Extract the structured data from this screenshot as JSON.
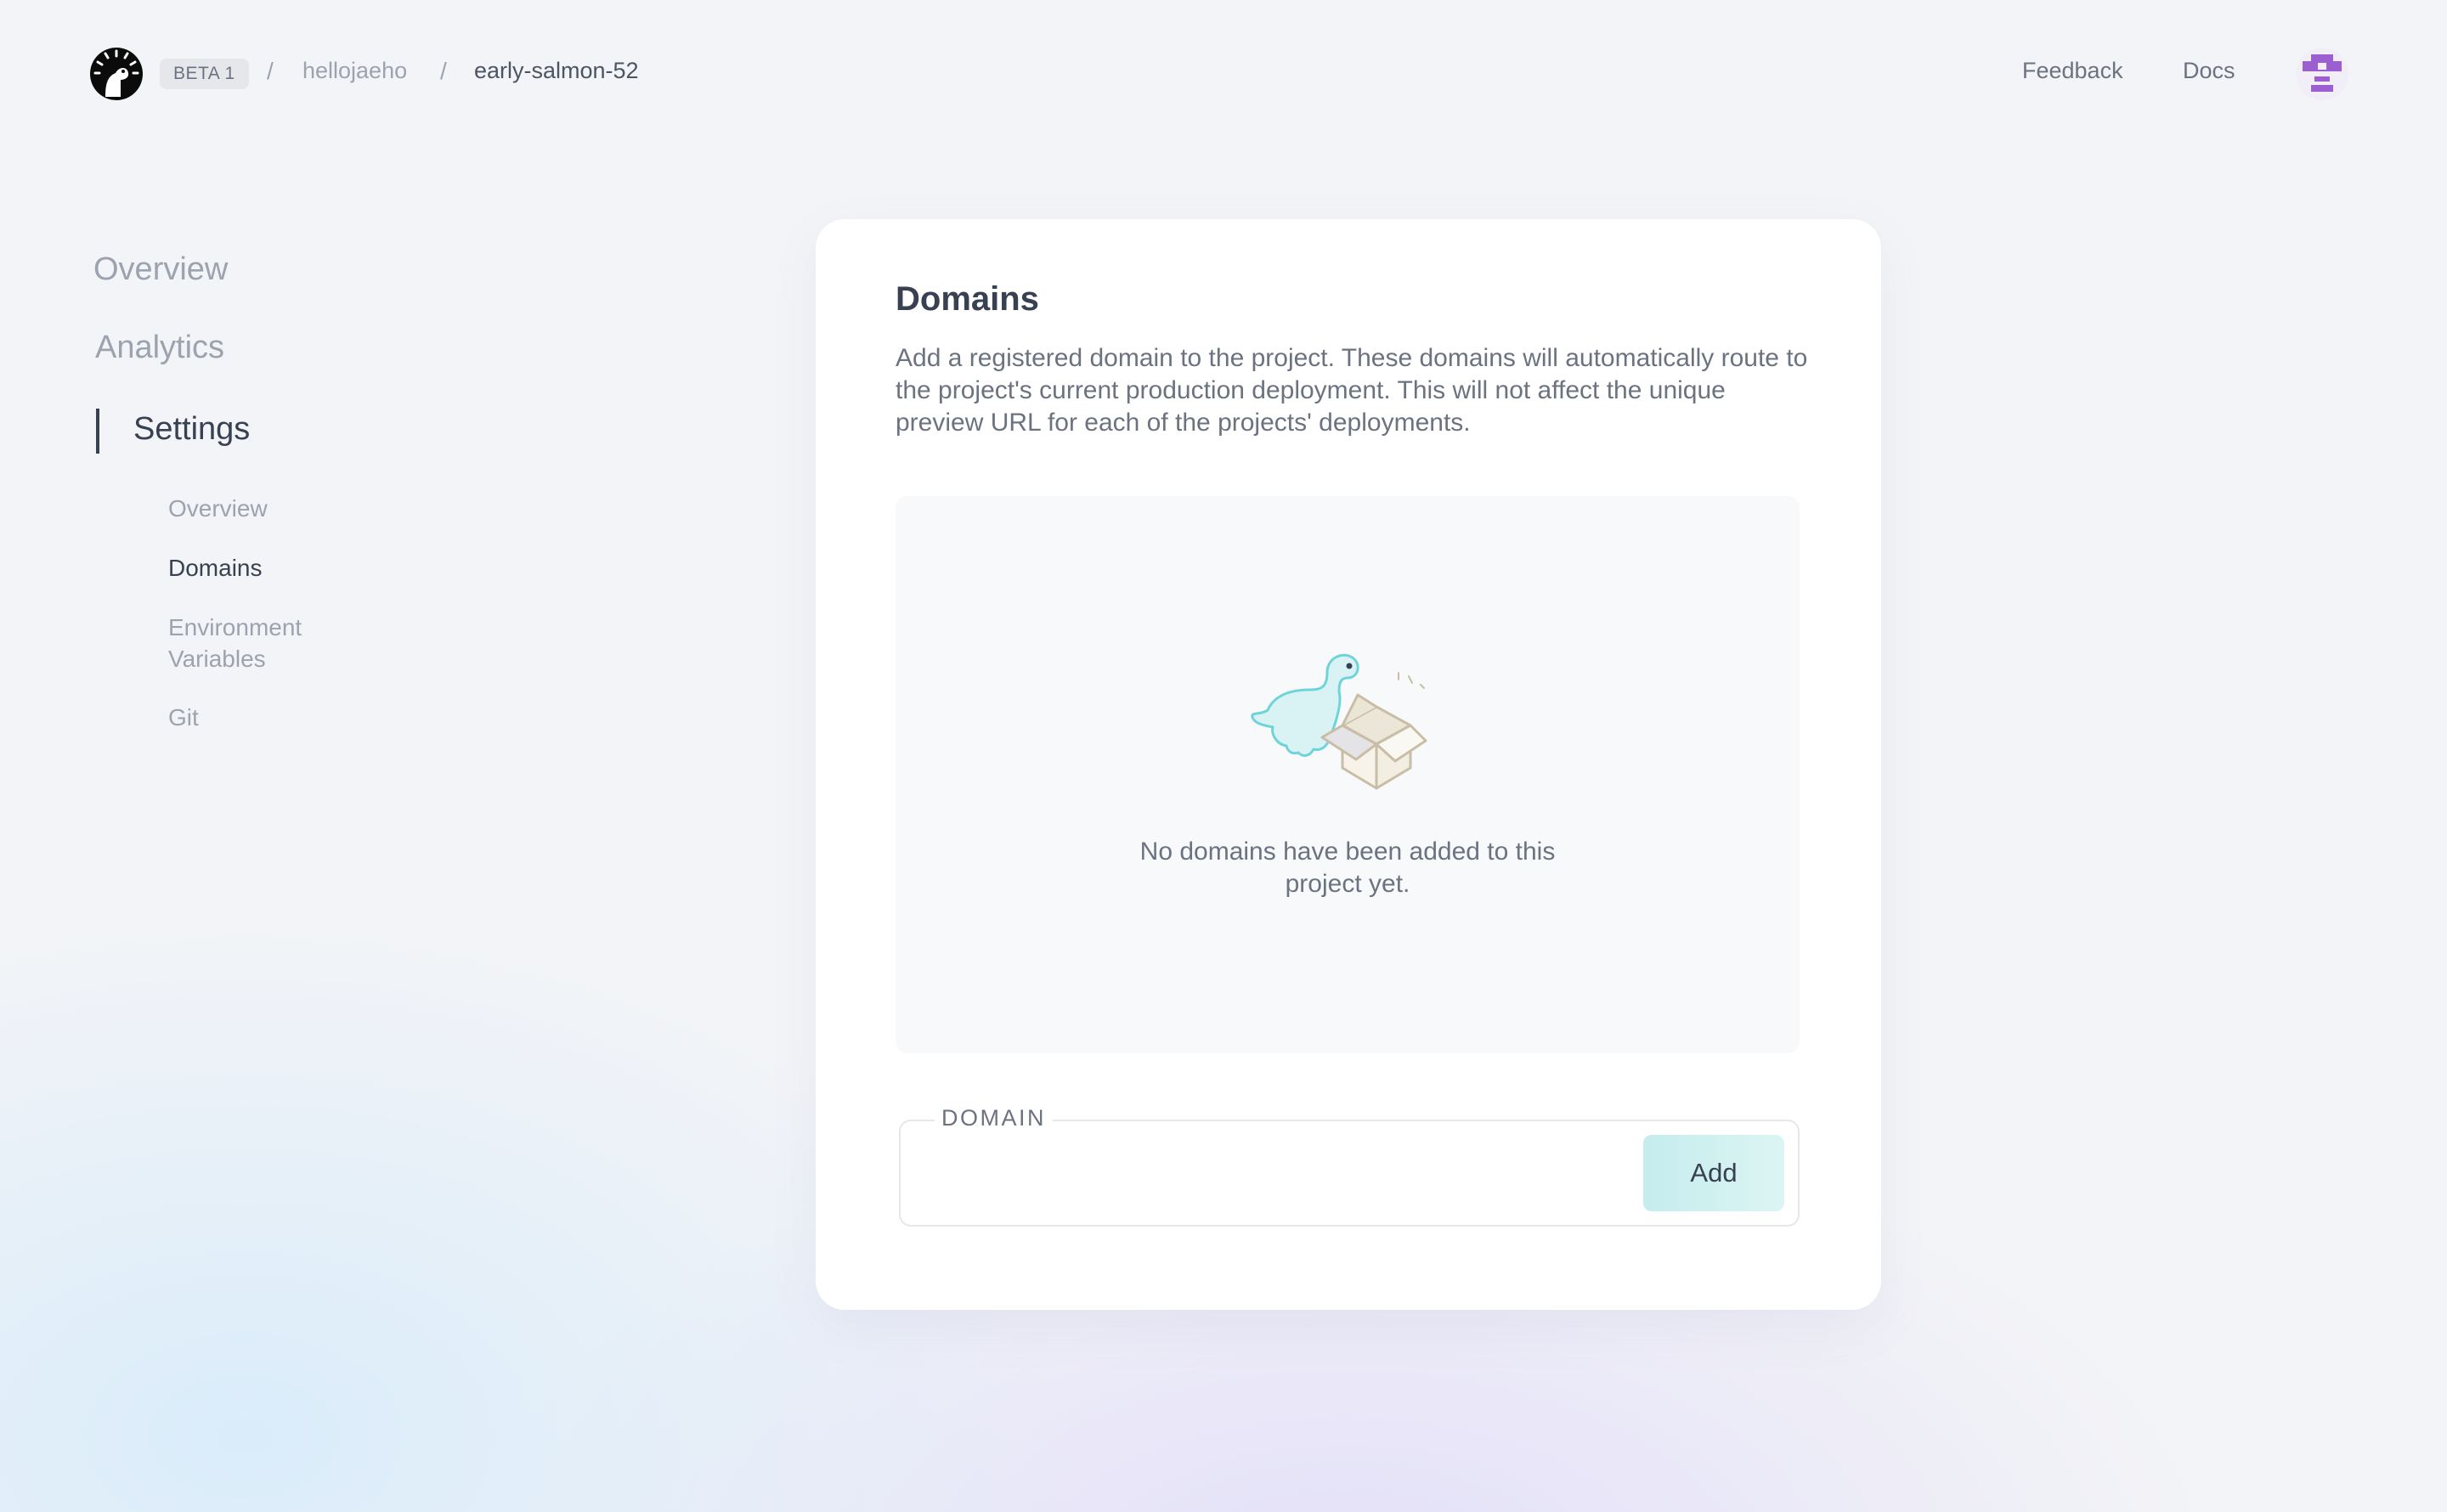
{
  "header": {
    "logo_icon": "deno-dino-logo",
    "beta_label": "BETA 1",
    "breadcrumb": {
      "separator": "/",
      "user": "hellojaeho",
      "project": "early-salmon-52"
    },
    "nav": {
      "feedback": "Feedback",
      "docs": "Docs"
    },
    "avatar_icon": "pixel-avatar",
    "avatar_color": "#9b5fd0"
  },
  "sidebar": {
    "items": [
      {
        "label": "Overview"
      },
      {
        "label": "Analytics"
      },
      {
        "label": "Settings",
        "active": true
      }
    ],
    "sub_items": [
      {
        "label": "Overview"
      },
      {
        "label": "Domains",
        "active": true
      },
      {
        "label": "Environment Variables"
      },
      {
        "label": "Git"
      }
    ]
  },
  "card": {
    "title": "Domains",
    "description": "Add a registered domain to the project. These domains will automatically route to the project's current production deployment. This will not affect the unique preview URL for each of the projects' deployments.",
    "empty_state": {
      "illustration": "dino-with-box-illustration",
      "text": "No domains have been added to this project yet."
    },
    "domain_field": {
      "label": "DOMAIN",
      "value": "",
      "add_label": "Add"
    }
  },
  "colors": {
    "accent_button": "#c5ecee",
    "dino": "#6fd4da",
    "box": "#c9bda5"
  }
}
